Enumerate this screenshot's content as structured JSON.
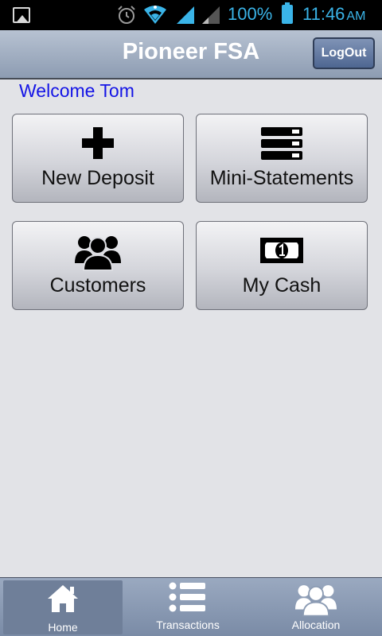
{
  "status_bar": {
    "battery": "100%",
    "time": "11:46",
    "ampm": "AM",
    "icons": [
      "gallery-icon",
      "alarm-icon",
      "wifi-icon",
      "signal-icon",
      "signal-weak-icon",
      "battery-icon"
    ],
    "accent_color": "#3ab4e8"
  },
  "header": {
    "title": "Pioneer FSA",
    "logout_label": "LogOut"
  },
  "welcome": "Welcome Tom",
  "tiles": [
    {
      "label": "New Deposit",
      "icon": "plus-icon"
    },
    {
      "label": "Mini-Statements",
      "icon": "list-stack-icon"
    },
    {
      "label": "Customers",
      "icon": "users-icon"
    },
    {
      "label": "My Cash",
      "icon": "banknote-icon"
    }
  ],
  "bottom_nav": [
    {
      "label": "Home",
      "icon": "home-icon",
      "active": true
    },
    {
      "label": "Transactions",
      "icon": "list-icon",
      "active": false
    },
    {
      "label": "Allocation",
      "icon": "users-icon",
      "active": false
    }
  ],
  "colors": {
    "background": "#e2e3e7",
    "welcome_text": "#1414e6",
    "header_gradient_top": "#b7c2d2",
    "header_gradient_bottom": "#8d9cb2"
  }
}
